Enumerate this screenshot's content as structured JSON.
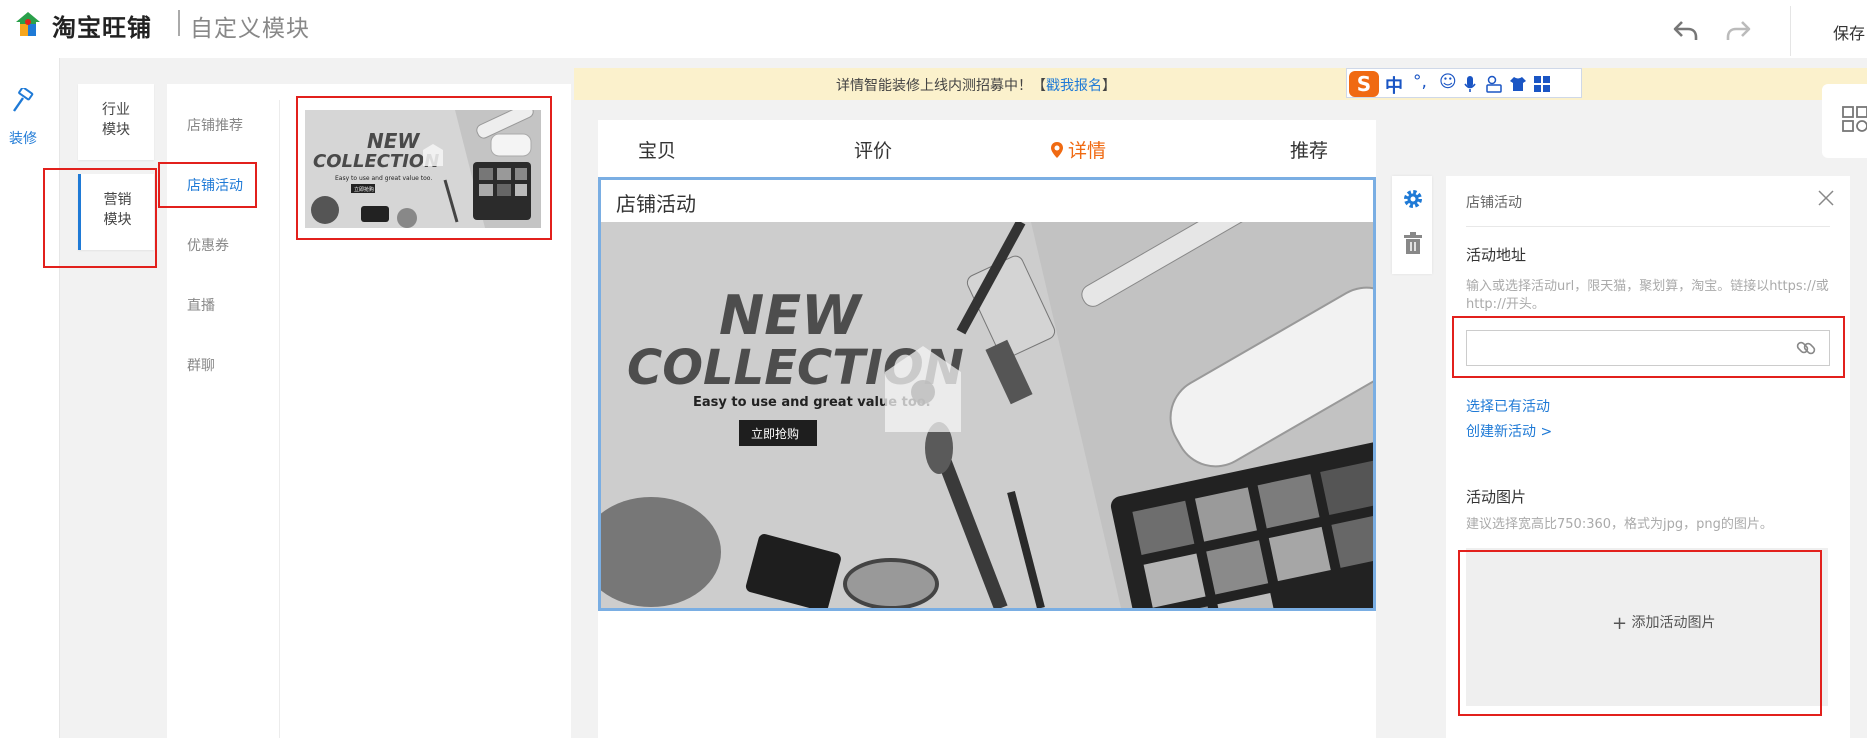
{
  "header": {
    "brand": "淘宝旺铺",
    "subtitle": "自定义模块",
    "undo_icon": "undo-arrow-icon",
    "redo_icon": "redo-arrow-icon",
    "save_label": "保存"
  },
  "toolbar": {
    "label": "装修",
    "icon": "hammer-icon"
  },
  "categories": [
    {
      "line1": "行业",
      "line2": "模块"
    },
    {
      "line1": "营销",
      "line2": "模块"
    }
  ],
  "modules": {
    "items": [
      {
        "label": "店铺推荐"
      },
      {
        "label": "店铺活动"
      },
      {
        "label": "优惠券"
      },
      {
        "label": "直播"
      },
      {
        "label": "群聊"
      }
    ],
    "active_index": 1
  },
  "notice": {
    "text": "详情智能装修上线内测招募中！【",
    "link": "戳我报名",
    "text_after": "】"
  },
  "ime": {
    "logo": "S",
    "mode": "中"
  },
  "preview": {
    "tabs": [
      "宝贝",
      "评价",
      "详情",
      "推荐"
    ],
    "active_tab": 2,
    "module_title": "店铺活动",
    "banner": {
      "line1": "NEW",
      "line2": "COLLECTION",
      "tagline": "Easy to use and great value too.",
      "button": "立即抢购"
    }
  },
  "thumb": {
    "line1": "NEW",
    "line2": "COLLECTION",
    "tagline": "Easy to use and great value too.",
    "button": "立即抢购"
  },
  "settings": {
    "title": "店铺活动",
    "address_label": "活动地址",
    "address_hint": "输入或选择活动url，限天猫，聚划算，淘宝。链接以https://或http://开头。",
    "url_value": "",
    "select_existing": "选择已有活动",
    "create_new": "创建新活动 >",
    "image_label": "活动图片",
    "image_hint": "建议选择宽高比750:360，格式为jpg，png的图片。",
    "add_image": "添加活动图片"
  },
  "colors": {
    "accent": "#1f7ad6",
    "active_tab": "#f06a12",
    "highlight": "#e2201c",
    "notice_bg": "#fbf1cc"
  }
}
